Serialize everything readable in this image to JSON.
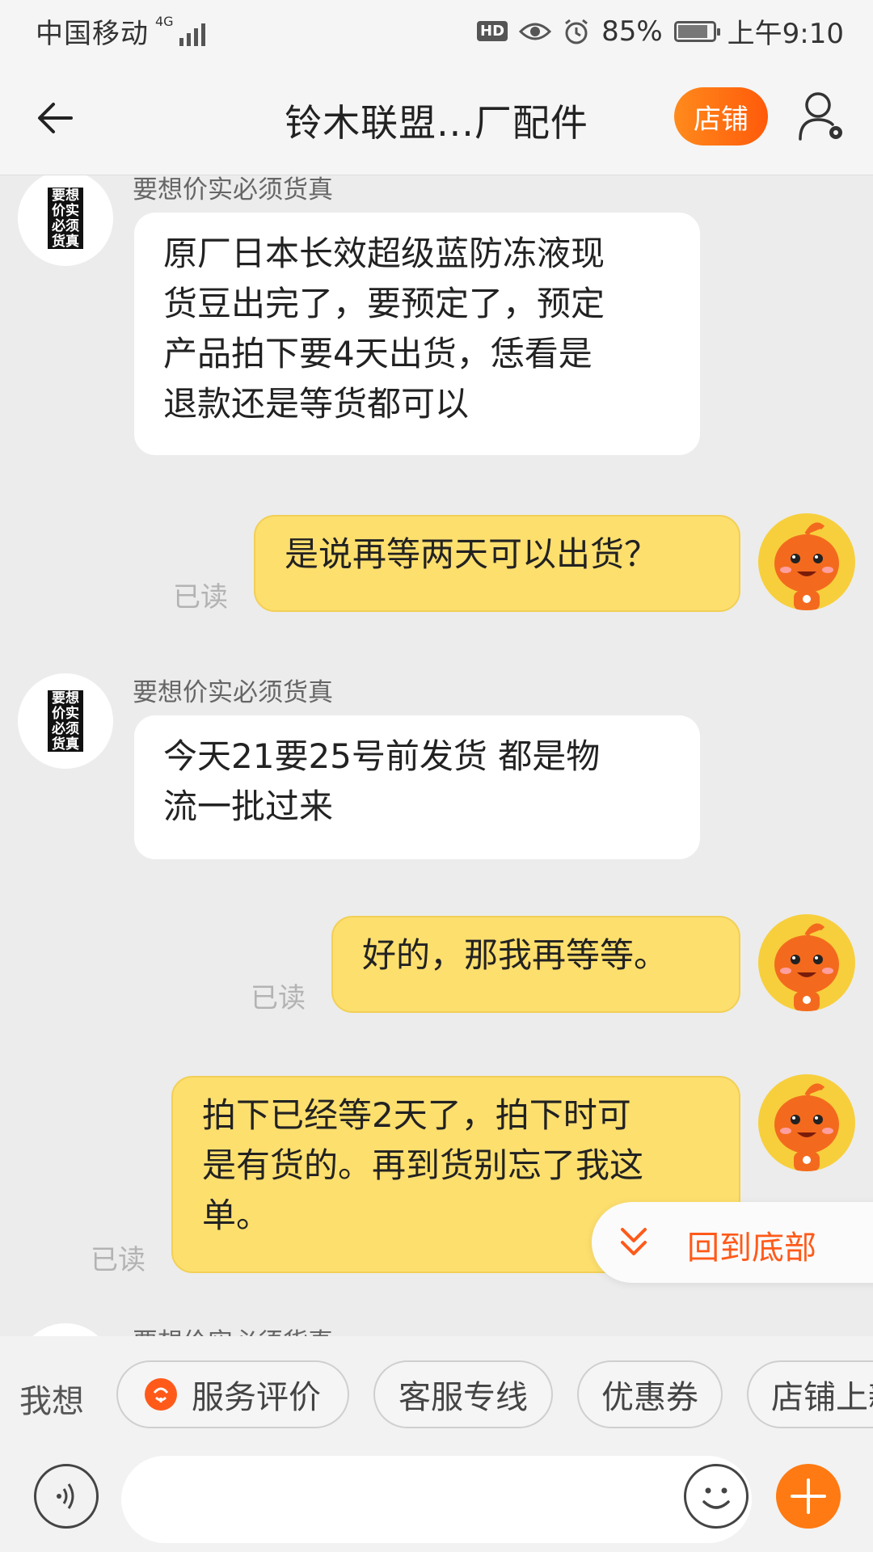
{
  "status_bar": {
    "carrier": "中国移动",
    "network": "4G",
    "hd": "HD",
    "battery": "85%",
    "battery_level": 0.85,
    "time": "上午9:10"
  },
  "header": {
    "title": "铃木联盟...厂配件",
    "store_button": "店铺"
  },
  "messages": [
    {
      "from": "shop",
      "sender": "要想价实必须货真",
      "text_lines": [
        "原厂日本长效超级蓝防冻液现",
        "货豆出完了，要预定了，预定",
        "产品拍下要4天出货，恁看是",
        "退款还是等货都可以"
      ]
    },
    {
      "from": "me",
      "text_lines": [
        "是说再等两天可以出货？"
      ],
      "read": "已读"
    },
    {
      "from": "shop",
      "sender": "要想价实必须货真",
      "text_lines": [
        "今天21要25号前发货 都是物",
        "流一批过来"
      ]
    },
    {
      "from": "me",
      "text_lines": [
        "好的，那我再等等。"
      ],
      "read": "已读"
    },
    {
      "from": "me",
      "text_lines": [
        "拍下已经等2天了，拍下时可",
        "是有货的。再到货别忘了我这",
        "单。"
      ],
      "read": "已读"
    }
  ],
  "shop_avatar_text": "要想价实必须货真",
  "partial_sender": "要想价实必须货真",
  "scroll_to_bottom": "回到底部",
  "quick_actions": {
    "label": "我想",
    "chips": [
      "服务评价",
      "客服专线",
      "优惠券",
      "店铺上新"
    ]
  },
  "input": {
    "placeholder": ""
  },
  "colors": {
    "accent": "#ff5a1a",
    "my_bubble": "#fddf6e",
    "background": "#ececec"
  }
}
